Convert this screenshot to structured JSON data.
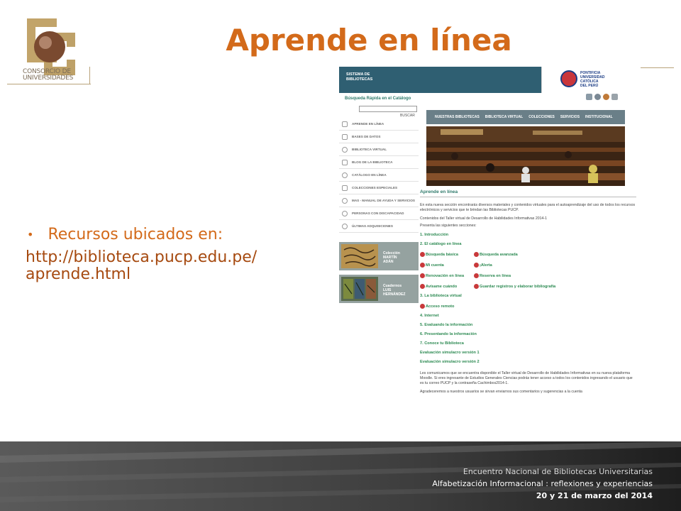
{
  "logo": {
    "line1": "CONSORCIO DE",
    "line2": "UNIVERSIDADES"
  },
  "title": "Aprende en línea",
  "bullet": {
    "text": "Recursos ubicados en:",
    "url_line1": "http://biblioteca.pucp.edu.pe/",
    "url_line2": "aprende.html"
  },
  "screenshot": {
    "header_left": [
      "SISTEMA DE",
      "BIBLIOTECAS"
    ],
    "header_right": [
      "PONTIFICIA",
      "UNIVERSIDAD",
      "CATÓLICA",
      "DEL PERÚ"
    ],
    "search_label": "Búsqueda Rápida en el Catálogo",
    "search_button": "BUSCAR",
    "sidebar": [
      {
        "label": "APRENDE EN LÍNEA",
        "icon": "monitor-icon"
      },
      {
        "label": "BASES DE DATOS",
        "icon": "database-icon"
      },
      {
        "label": "BIBLIOTECA VIRTUAL",
        "icon": "globe-icon"
      },
      {
        "label": "BLOG DE LA BIBLIOTECA",
        "icon": "blog-icon"
      },
      {
        "label": "CATÁLOGO EN LÍNEA",
        "icon": "search-icon"
      },
      {
        "label": "COLECCIONES ESPECIALES",
        "icon": "star-icon"
      },
      {
        "label": "MAS - MANUAL DE AYUDA Y SERVICIOS",
        "icon": "help-icon"
      },
      {
        "label": "PERSONAS CON DISCAPACIDAD",
        "icon": "accessibility-icon"
      },
      {
        "label": "ÚLTIMAS ADQUISICIONES",
        "icon": "info-icon"
      }
    ],
    "promos": [
      {
        "line1": "Colección",
        "line2": "MARTÍN",
        "line3": "ADÁN"
      },
      {
        "line1": "Cuadernos",
        "line2": "LUIS",
        "line3": "HERNÁNDEZ"
      }
    ],
    "nav": [
      "NUESTRAS BIBLIOTECAS",
      "BIBLIOTECA VIRTUAL",
      "COLECCIONES",
      "SERVICIOS",
      "INSTITUCIONAL"
    ],
    "content": {
      "title": "Aprende en línea",
      "intro": "En esta nueva sección encontrarás diversos materiales y contenidos virtuales para el autoaprendizaje del uso de todos los recursos electrónicos y servicios que te brindan las Bibliotecas PUCP.",
      "p2": "Contenidos del Taller virtual de Desarrollo de Habilidades Informativas 2014-1",
      "p3": "Presenta las siguientes secciones:",
      "s1": "1. Introducción",
      "s2": "2. El catálogo en línea",
      "row1": [
        "Búsqueda básica",
        "Búsqueda avanzada"
      ],
      "row2": [
        "Mi cuenta",
        "¡Alerta"
      ],
      "row3": [
        "Renovación en línea",
        "Reserva en línea"
      ],
      "row4": [
        "Avísame cuándo",
        "Guardar registros y elaborar bibliografía"
      ],
      "s3": "3. La biblioteca virtual",
      "remote": "Acceso remoto",
      "s4": "4. Internet",
      "s5": "5. Evaluando la información",
      "s6": "6. Presentando la información",
      "s7": "7. Conoce tu Biblioteca",
      "ev1": "Evaluación simulacro versión 1",
      "ev2": "Evaluación simulacro versión 2",
      "bottom1": "Les comunicamos que se encuentra disponible el Taller virtual de Desarrollo de Habilidades Informativas en su nueva plataforma Moodle. Si eres ingresante de Estudios Generales Ciencias podrás tener acceso a todos los contenidos ingresando el usuario que es tu correo PUCP y la contraseña Cachimbos2014-1.",
      "bottom2": "Agradeceremos a nuestros usuarios se sirvan enviarnos sus comentarios y sugerencias a la cuenta"
    }
  },
  "footer": {
    "line1": "Encuentro Nacional de Bibliotecas Universitarias",
    "line2": "Alfabetización Informacional : reflexiones y experiencias",
    "line3": "20 y 21 de marzo del 2014"
  },
  "colors": {
    "title": "#d36a1a",
    "accent": "#2f5f72",
    "link": "#2c8a52"
  }
}
